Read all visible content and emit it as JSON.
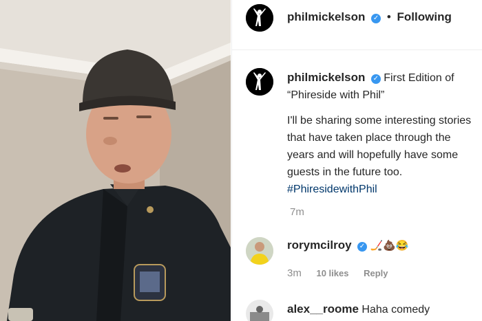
{
  "header": {
    "username": "philmickelson",
    "separator": "•",
    "follow_status": "Following"
  },
  "caption": {
    "username": "philmickelson",
    "first_line": "First Edition of",
    "lines": [
      "“Phireside with Phil”",
      "I'll be sharing some interesting stories",
      "that have taken place through the",
      "years and will hopefully have some",
      "guests in the future too."
    ],
    "hashtag": "#PhiresidewithPhil",
    "age": "7m"
  },
  "comments": [
    {
      "username": "rorymcilroy",
      "text": "🏒💩😂",
      "age": "3m",
      "likes": "10 likes",
      "reply": "Reply"
    },
    {
      "username": "alex__roome",
      "text": "Haha comedy"
    }
  ],
  "colors": {
    "verified": "#3897f0",
    "hashtag": "#00376b",
    "muted": "#8e8e8e"
  }
}
